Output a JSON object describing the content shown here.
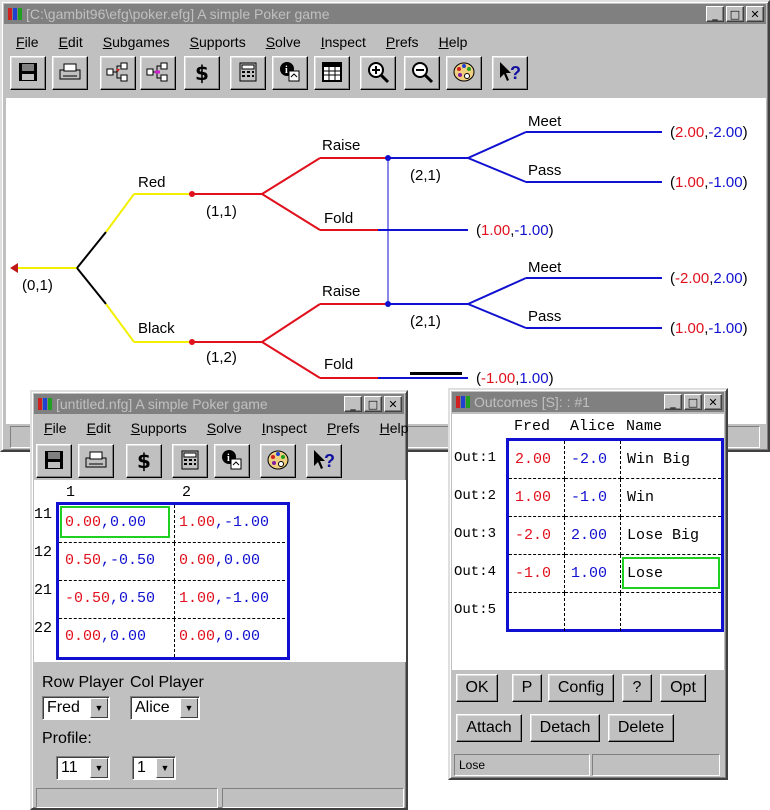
{
  "main": {
    "title": "[C:\\gambit96\\efg\\poker.efg] A simple Poker game",
    "menu": [
      "File",
      "Edit",
      "Subgames",
      "Supports",
      "Solve",
      "Inspect",
      "Prefs",
      "Help"
    ],
    "toolbar_icons": [
      "save-icon",
      "print-icon",
      "add-node-icon",
      "delete-node-icon",
      "dollar-icon",
      "calculator-icon",
      "info-icon",
      "grid-icon",
      "zoom-in-icon",
      "zoom-out-icon",
      "palette-icon",
      "help-pointer-icon"
    ],
    "tree": {
      "root": "(0,1)",
      "chance_labels": [
        "Red",
        "Black"
      ],
      "nodes": [
        "(1,1)",
        "(1,2)",
        "(2,1)",
        "(2,1)"
      ],
      "actions1": [
        "Raise",
        "Fold",
        "Raise",
        "Fold"
      ],
      "actions2": [
        "Meet",
        "Pass",
        "Meet",
        "Pass"
      ],
      "payoffs": [
        {
          "a": "2.00",
          "b": "-2.00"
        },
        {
          "a": "1.00",
          "b": "-1.00"
        },
        {
          "a": "1.00",
          "b": "-1.00"
        },
        {
          "a": "-2.00",
          "b": "2.00"
        },
        {
          "a": "1.00",
          "b": "-1.00"
        },
        {
          "a": "-1.00",
          "b": "1.00"
        }
      ]
    }
  },
  "nfg": {
    "title": "[untitled.nfg] A simple Poker game",
    "menu": [
      "File",
      "Edit",
      "Supports",
      "Solve",
      "Inspect",
      "Prefs",
      "Help"
    ],
    "toolbar_icons": [
      "save-icon",
      "print-icon",
      "dollar-icon",
      "calculator-icon",
      "info-icon",
      "palette-icon",
      "help-pointer-icon"
    ],
    "col_headers": [
      "1",
      "2"
    ],
    "row_headers": [
      "11",
      "12",
      "21",
      "22"
    ],
    "cells": [
      [
        {
          "a": "0.00",
          "b": "0.00"
        },
        {
          "a": "1.00",
          "b": "-1.00"
        }
      ],
      [
        {
          "a": "0.50",
          "b": "-0.50"
        },
        {
          "a": "0.00",
          "b": "0.00"
        }
      ],
      [
        {
          "a": "-0.50",
          "b": "0.50"
        },
        {
          "a": "1.00",
          "b": "-1.00"
        }
      ],
      [
        {
          "a": "0.00",
          "b": "0.00"
        },
        {
          "a": "0.00",
          "b": "0.00"
        }
      ]
    ],
    "row_player_label": "Row Player",
    "col_player_label": "Col Player",
    "row_player": "Fred",
    "col_player": "Alice",
    "profile_label": "Profile:",
    "profile_row": "11",
    "profile_col": "1"
  },
  "outcomes": {
    "title": "Outcomes [S]: : #1",
    "headers": [
      "Fred",
      "Alice",
      "Name"
    ],
    "rows": [
      {
        "label": "Out:1",
        "fred": "2.00",
        "alice": "-2.0",
        "name": "Win Big"
      },
      {
        "label": "Out:2",
        "fred": "1.00",
        "alice": "-1.0",
        "name": "Win"
      },
      {
        "label": "Out:3",
        "fred": "-2.0",
        "alice": "2.00",
        "name": "Lose Big"
      },
      {
        "label": "Out:4",
        "fred": "-1.0",
        "alice": "1.00",
        "name": "Lose"
      },
      {
        "label": "Out:5",
        "fred": "",
        "alice": "",
        "name": ""
      }
    ],
    "buttons1": [
      "OK",
      "P",
      "Config",
      "?",
      "Opt"
    ],
    "buttons2": [
      "Attach",
      "Detach",
      "Delete"
    ],
    "status": "Lose"
  },
  "colors": {
    "red": "#e0101c",
    "blue": "#1010d0",
    "yellow": "#f0f000",
    "titlebar": "#808080"
  }
}
